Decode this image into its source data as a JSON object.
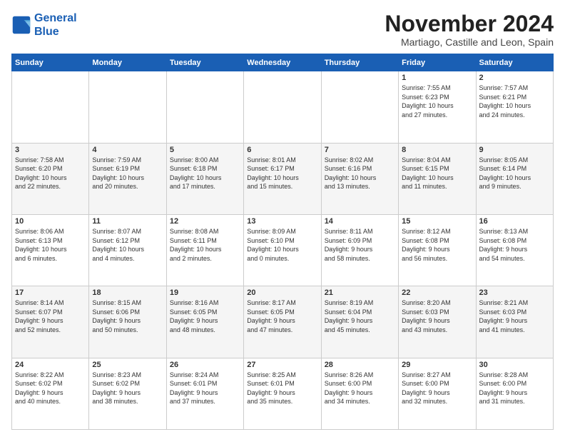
{
  "logo": {
    "line1": "General",
    "line2": "Blue"
  },
  "title": "November 2024",
  "subtitle": "Martiago, Castille and Leon, Spain",
  "days_header": [
    "Sunday",
    "Monday",
    "Tuesday",
    "Wednesday",
    "Thursday",
    "Friday",
    "Saturday"
  ],
  "weeks": [
    [
      {
        "day": "",
        "info": ""
      },
      {
        "day": "",
        "info": ""
      },
      {
        "day": "",
        "info": ""
      },
      {
        "day": "",
        "info": ""
      },
      {
        "day": "",
        "info": ""
      },
      {
        "day": "1",
        "info": "Sunrise: 7:55 AM\nSunset: 6:23 PM\nDaylight: 10 hours\nand 27 minutes."
      },
      {
        "day": "2",
        "info": "Sunrise: 7:57 AM\nSunset: 6:21 PM\nDaylight: 10 hours\nand 24 minutes."
      }
    ],
    [
      {
        "day": "3",
        "info": "Sunrise: 7:58 AM\nSunset: 6:20 PM\nDaylight: 10 hours\nand 22 minutes."
      },
      {
        "day": "4",
        "info": "Sunrise: 7:59 AM\nSunset: 6:19 PM\nDaylight: 10 hours\nand 20 minutes."
      },
      {
        "day": "5",
        "info": "Sunrise: 8:00 AM\nSunset: 6:18 PM\nDaylight: 10 hours\nand 17 minutes."
      },
      {
        "day": "6",
        "info": "Sunrise: 8:01 AM\nSunset: 6:17 PM\nDaylight: 10 hours\nand 15 minutes."
      },
      {
        "day": "7",
        "info": "Sunrise: 8:02 AM\nSunset: 6:16 PM\nDaylight: 10 hours\nand 13 minutes."
      },
      {
        "day": "8",
        "info": "Sunrise: 8:04 AM\nSunset: 6:15 PM\nDaylight: 10 hours\nand 11 minutes."
      },
      {
        "day": "9",
        "info": "Sunrise: 8:05 AM\nSunset: 6:14 PM\nDaylight: 10 hours\nand 9 minutes."
      }
    ],
    [
      {
        "day": "10",
        "info": "Sunrise: 8:06 AM\nSunset: 6:13 PM\nDaylight: 10 hours\nand 6 minutes."
      },
      {
        "day": "11",
        "info": "Sunrise: 8:07 AM\nSunset: 6:12 PM\nDaylight: 10 hours\nand 4 minutes."
      },
      {
        "day": "12",
        "info": "Sunrise: 8:08 AM\nSunset: 6:11 PM\nDaylight: 10 hours\nand 2 minutes."
      },
      {
        "day": "13",
        "info": "Sunrise: 8:09 AM\nSunset: 6:10 PM\nDaylight: 10 hours\nand 0 minutes."
      },
      {
        "day": "14",
        "info": "Sunrise: 8:11 AM\nSunset: 6:09 PM\nDaylight: 9 hours\nand 58 minutes."
      },
      {
        "day": "15",
        "info": "Sunrise: 8:12 AM\nSunset: 6:08 PM\nDaylight: 9 hours\nand 56 minutes."
      },
      {
        "day": "16",
        "info": "Sunrise: 8:13 AM\nSunset: 6:08 PM\nDaylight: 9 hours\nand 54 minutes."
      }
    ],
    [
      {
        "day": "17",
        "info": "Sunrise: 8:14 AM\nSunset: 6:07 PM\nDaylight: 9 hours\nand 52 minutes."
      },
      {
        "day": "18",
        "info": "Sunrise: 8:15 AM\nSunset: 6:06 PM\nDaylight: 9 hours\nand 50 minutes."
      },
      {
        "day": "19",
        "info": "Sunrise: 8:16 AM\nSunset: 6:05 PM\nDaylight: 9 hours\nand 48 minutes."
      },
      {
        "day": "20",
        "info": "Sunrise: 8:17 AM\nSunset: 6:05 PM\nDaylight: 9 hours\nand 47 minutes."
      },
      {
        "day": "21",
        "info": "Sunrise: 8:19 AM\nSunset: 6:04 PM\nDaylight: 9 hours\nand 45 minutes."
      },
      {
        "day": "22",
        "info": "Sunrise: 8:20 AM\nSunset: 6:03 PM\nDaylight: 9 hours\nand 43 minutes."
      },
      {
        "day": "23",
        "info": "Sunrise: 8:21 AM\nSunset: 6:03 PM\nDaylight: 9 hours\nand 41 minutes."
      }
    ],
    [
      {
        "day": "24",
        "info": "Sunrise: 8:22 AM\nSunset: 6:02 PM\nDaylight: 9 hours\nand 40 minutes."
      },
      {
        "day": "25",
        "info": "Sunrise: 8:23 AM\nSunset: 6:02 PM\nDaylight: 9 hours\nand 38 minutes."
      },
      {
        "day": "26",
        "info": "Sunrise: 8:24 AM\nSunset: 6:01 PM\nDaylight: 9 hours\nand 37 minutes."
      },
      {
        "day": "27",
        "info": "Sunrise: 8:25 AM\nSunset: 6:01 PM\nDaylight: 9 hours\nand 35 minutes."
      },
      {
        "day": "28",
        "info": "Sunrise: 8:26 AM\nSunset: 6:00 PM\nDaylight: 9 hours\nand 34 minutes."
      },
      {
        "day": "29",
        "info": "Sunrise: 8:27 AM\nSunset: 6:00 PM\nDaylight: 9 hours\nand 32 minutes."
      },
      {
        "day": "30",
        "info": "Sunrise: 8:28 AM\nSunset: 6:00 PM\nDaylight: 9 hours\nand 31 minutes."
      }
    ]
  ]
}
